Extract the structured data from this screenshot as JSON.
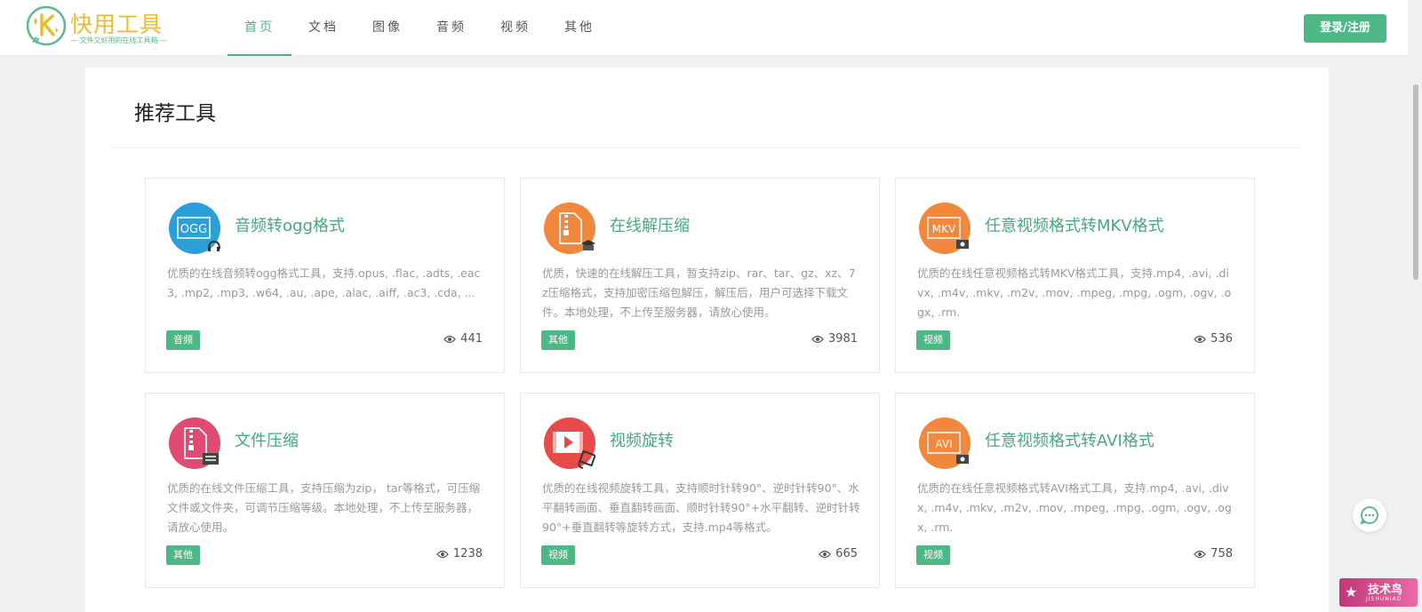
{
  "logo": {
    "title": "快用工具",
    "slogan": "— 文件又好用的在线工具箱 —"
  },
  "nav": [
    {
      "label": "首页",
      "active": true
    },
    {
      "label": "文档",
      "active": false
    },
    {
      "label": "图像",
      "active": false
    },
    {
      "label": "音频",
      "active": false
    },
    {
      "label": "视频",
      "active": false
    },
    {
      "label": "其他",
      "active": false
    }
  ],
  "header": {
    "login_label": "登录/注册"
  },
  "section": {
    "title": "推荐工具"
  },
  "cards": [
    {
      "title": "音频转ogg格式",
      "icon": "ogg-audio-icon",
      "icon_text": "OGG",
      "icon_color": "#2a9fd8",
      "desc": "优质的在线音频转ogg格式工具，支持.opus, .flac, .adts, .eac3, .mp2, .mp3, .w64, .au, .ape, .alac, .aiff, .ac3, .cda, ...",
      "tag": "音频",
      "views": "441"
    },
    {
      "title": "在线解压缩",
      "icon": "unzip-archive-icon",
      "icon_text": "",
      "icon_color": "#f2883d",
      "desc": "优质，快速的在线解压工具，暂支持zip、rar、tar、gz、xz、7z压缩格式，支持加密压缩包解压，解压后，用户可选择下载文件。本地处理，不上传至服务器，请放心使用。",
      "tag": "其他",
      "views": "3981"
    },
    {
      "title": "任意视频格式转MKV格式",
      "icon": "mkv-video-icon",
      "icon_text": "MKV",
      "icon_color": "#f2883d",
      "desc": "优质的在线任意视频格式转MKV格式工具，支持.mp4, .avi, .divx, .m4v, .mkv, .m2v, .mov, .mpeg, .mpg, .ogm, .ogv, .ogx, .rm.",
      "tag": "视频",
      "views": "536"
    },
    {
      "title": "文件压缩",
      "icon": "zip-archive-icon",
      "icon_text": "",
      "icon_color": "#e04b73",
      "desc": "优质的在线文件压缩工具，支持压缩为zip， tar等格式，可压缩文件或文件夹，可调节压缩等级。本地处理，不上传至服务器，请放心使用。",
      "tag": "其他",
      "views": "1238"
    },
    {
      "title": "视频旋转",
      "icon": "video-rotate-icon",
      "icon_text": "",
      "icon_color": "#e84a4a",
      "desc": "优质的在线视频旋转工具，支持顺时针转90°、逆时针转90°、水平翻转画面、垂直翻转画面、顺时针转90°+水平翻转、逆时针转90°+垂直翻转等旋转方式，支持.mp4等格式。",
      "tag": "视频",
      "views": "665"
    },
    {
      "title": "任意视频格式转AVI格式",
      "icon": "avi-video-icon",
      "icon_text": "AVI",
      "icon_color": "#f2883d",
      "desc": "优质的在线任意视频格式转AVI格式工具，支持.mp4, .avi, .divx, .m4v, .mkv, .m2v, .mov, .mpeg, .mpg, .ogm, .ogv, .ogx, .rm.",
      "tag": "视频",
      "views": "758"
    }
  ],
  "badge": {
    "text": "技术鸟",
    "sub": "JISHUNIAO"
  },
  "colors": {
    "accent": "#4db886",
    "title_green": "#4aa87b",
    "logo_yellow": "#e9bd2b"
  }
}
